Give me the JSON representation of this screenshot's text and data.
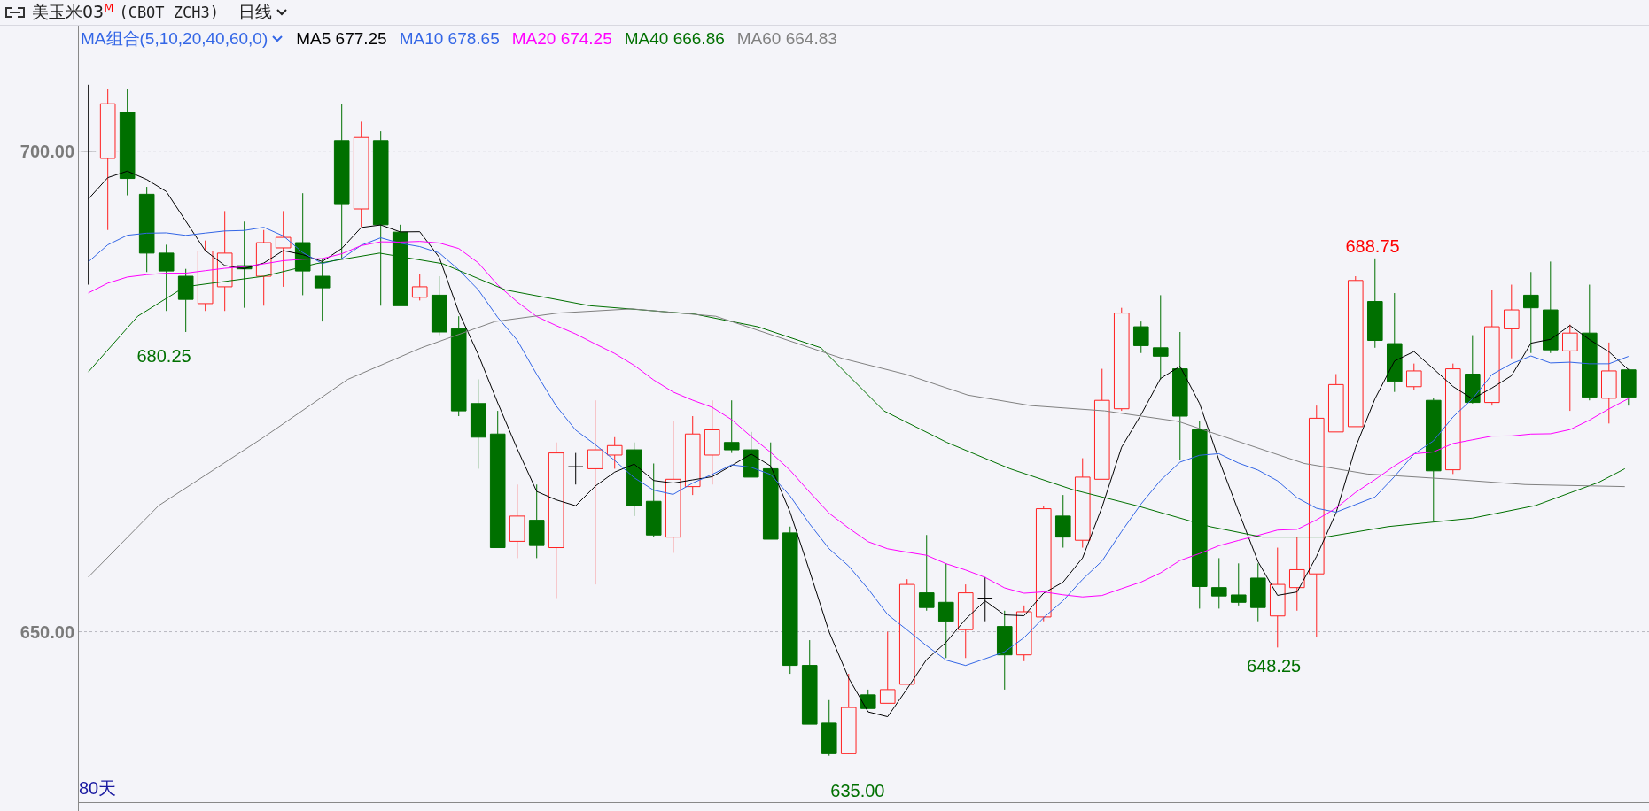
{
  "header": {
    "title": "美玉米03",
    "title_mark": "M",
    "code": "(CBOT ZCH3)",
    "period": "日线"
  },
  "legend": {
    "combo": "MA组合(5,10,20,40,60,0)",
    "items": [
      {
        "label": "MA5 677.25",
        "color": "#000000"
      },
      {
        "label": "MA10 678.65",
        "color": "#3366e6"
      },
      {
        "label": "MA20 674.25",
        "color": "#ff00ff"
      },
      {
        "label": "MA40 666.86",
        "color": "#007000"
      },
      {
        "label": "MA60 664.83",
        "color": "#808080"
      }
    ]
  },
  "chart": {
    "y_ticks": [
      "700.00",
      "650.00"
    ],
    "annotations": [
      {
        "text": "688.75",
        "color": "#ff0000"
      },
      {
        "text": "680.25",
        "color": "#007000"
      },
      {
        "text": "635.00",
        "color": "#007000"
      },
      {
        "text": "648.25",
        "color": "#007000"
      }
    ],
    "range_label": "80天"
  }
}
